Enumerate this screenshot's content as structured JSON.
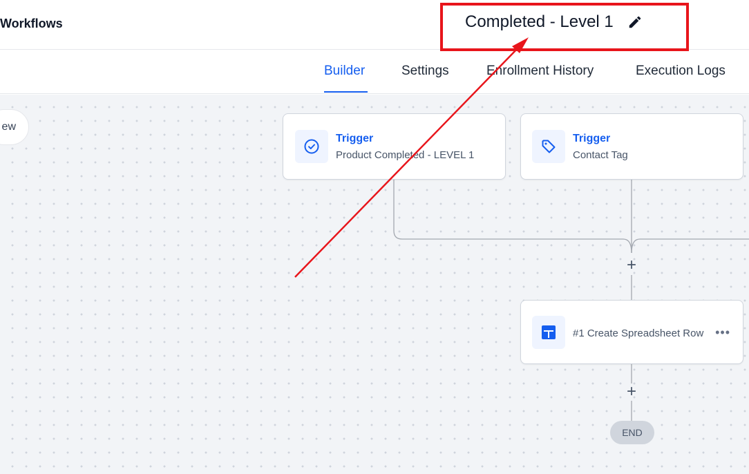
{
  "header": {
    "breadcrumb": "Workflows",
    "workflow_title": "Completed - Level 1"
  },
  "tabs": [
    {
      "label": "Builder",
      "active": true
    },
    {
      "label": "Settings",
      "active": false
    },
    {
      "label": "Enrollment History",
      "active": false
    },
    {
      "label": "Execution Logs",
      "active": false
    }
  ],
  "canvas": {
    "left_pill_text": "ew",
    "triggers": [
      {
        "type": "Trigger",
        "description": "Product Completed - LEVEL 1",
        "icon": "check-circle-icon"
      },
      {
        "type": "Trigger",
        "description": "Contact Tag",
        "icon": "tag-icon"
      }
    ],
    "actions": [
      {
        "label": "#1 Create Spreadsheet Row",
        "icon": "spreadsheet-icon",
        "menu": "•••"
      }
    ],
    "add_symbol": "+",
    "end_label": "END"
  },
  "colors": {
    "accent": "#155eef",
    "annotation": "#e8151b",
    "canvas_bg": "#f2f4f7",
    "connector": "#a3a8b0"
  }
}
